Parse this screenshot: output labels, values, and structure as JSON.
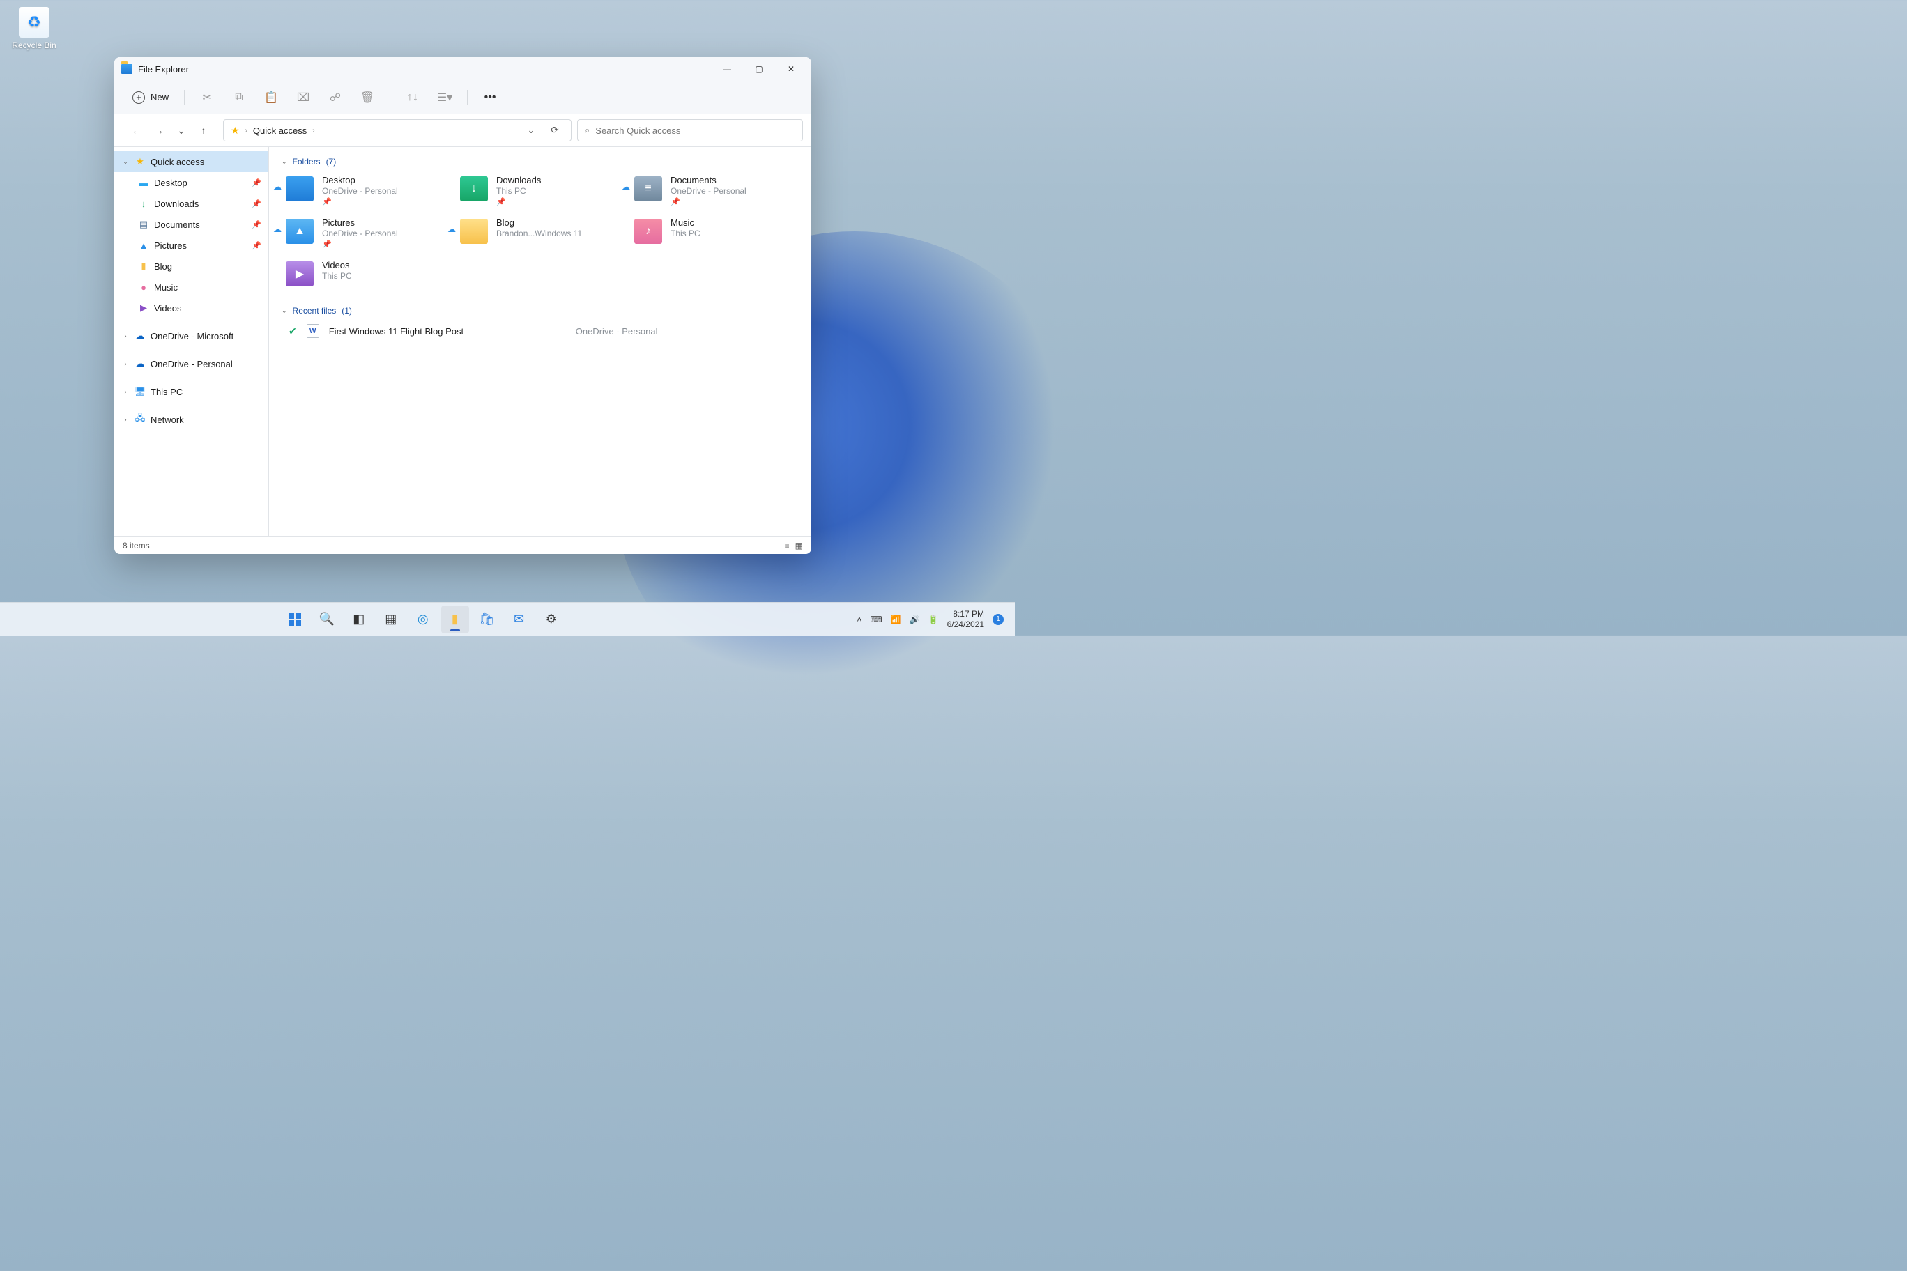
{
  "desktop": {
    "recycle_bin": "Recycle Bin"
  },
  "window": {
    "title": "File Explorer",
    "toolbar": {
      "new": "New"
    },
    "address": {
      "crumb": "Quick access"
    },
    "search": {
      "placeholder": "Search Quick access"
    },
    "sidebar": {
      "quick_access": "Quick access",
      "items": {
        "desktop": "Desktop",
        "downloads": "Downloads",
        "documents": "Documents",
        "pictures": "Pictures",
        "blog": "Blog",
        "music": "Music",
        "videos": "Videos"
      },
      "onedrive_ms": "OneDrive - Microsoft",
      "onedrive_personal": "OneDrive - Personal",
      "this_pc": "This PC",
      "network": "Network"
    },
    "sections": {
      "folders": {
        "label": "Folders",
        "count": "(7)"
      },
      "recent": {
        "label": "Recent files",
        "count": "(1)"
      }
    },
    "folders": [
      {
        "name": "Desktop",
        "loc": "OneDrive - Personal",
        "pinned": true,
        "color": "blue",
        "cloud": true,
        "glyph": ""
      },
      {
        "name": "Downloads",
        "loc": "This PC",
        "pinned": true,
        "color": "green",
        "cloud": false,
        "glyph": "↓"
      },
      {
        "name": "Documents",
        "loc": "OneDrive - Personal",
        "pinned": true,
        "color": "gray",
        "cloud": true,
        "glyph": "≡"
      },
      {
        "name": "Pictures",
        "loc": "OneDrive - Personal",
        "pinned": true,
        "color": "sky",
        "cloud": true,
        "glyph": "▲"
      },
      {
        "name": "Blog",
        "loc": "Brandon...\\Windows 11",
        "pinned": false,
        "color": "yellow",
        "cloud": true,
        "glyph": ""
      },
      {
        "name": "Music",
        "loc": "This PC",
        "pinned": false,
        "color": "pink",
        "cloud": false,
        "glyph": "♪"
      },
      {
        "name": "Videos",
        "loc": "This PC",
        "pinned": false,
        "color": "purple",
        "cloud": false,
        "glyph": "▶"
      }
    ],
    "recent_files": [
      {
        "name": "First Windows 11 Flight Blog Post",
        "loc": "OneDrive - Personal"
      }
    ],
    "status": {
      "items": "8 items"
    }
  },
  "taskbar": {
    "time": "8:17 PM",
    "date": "6/24/2021",
    "notif": "1"
  }
}
